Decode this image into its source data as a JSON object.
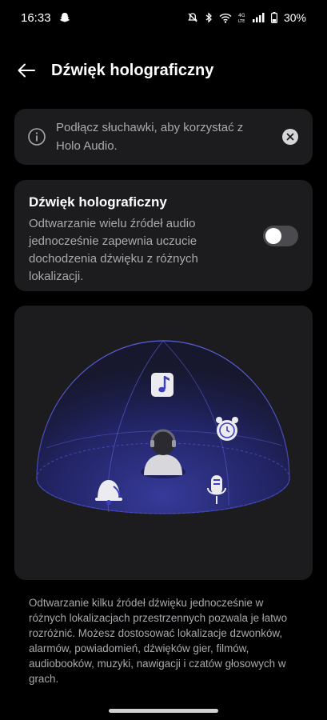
{
  "status_bar": {
    "time": "16:33",
    "battery": "30%",
    "colors": {
      "text": "#ffffff"
    }
  },
  "header": {
    "title": "Dźwięk holograficzny"
  },
  "info_banner": {
    "text": "Podłącz słuchawki, aby korzystać z Holo Audio."
  },
  "holo_setting": {
    "title": "Dźwięk holograficzny",
    "description": "Odtwarzanie wielu źródeł audio jednocześnie zapewnia uczucie dochodzenia dźwięku z różnych lokalizacji.",
    "enabled": false
  },
  "footer": {
    "text": "Odtwarzanie kilku źródeł dźwięku jednocześnie w różnych lokalizacjach przestrzennych pozwala je łatwo rozróżnić. Możesz dostosować lokalizacje dzwonków, alarmów, powiadomień, dźwięków gier, filmów, audiobooków, muzyki, nawigacji i czatów głosowych w grach."
  },
  "icons": {
    "status_left": [
      "snapchat-ghost-icon"
    ],
    "status_right": [
      "mute-icon",
      "bluetooth-icon",
      "wifi-icon",
      "volte-icon",
      "signal-icon",
      "battery-icon"
    ],
    "illustration": [
      "music-note-icon",
      "alarm-clock-icon",
      "bell-icon",
      "microphone-icon",
      "listener-avatar-icon"
    ]
  },
  "colors": {
    "background": "#000000",
    "card": "#1c1c1e",
    "secondary_text": "#a9a9ae",
    "dome": "#2b2f8a",
    "toggle_off": "#4a4a4f"
  }
}
